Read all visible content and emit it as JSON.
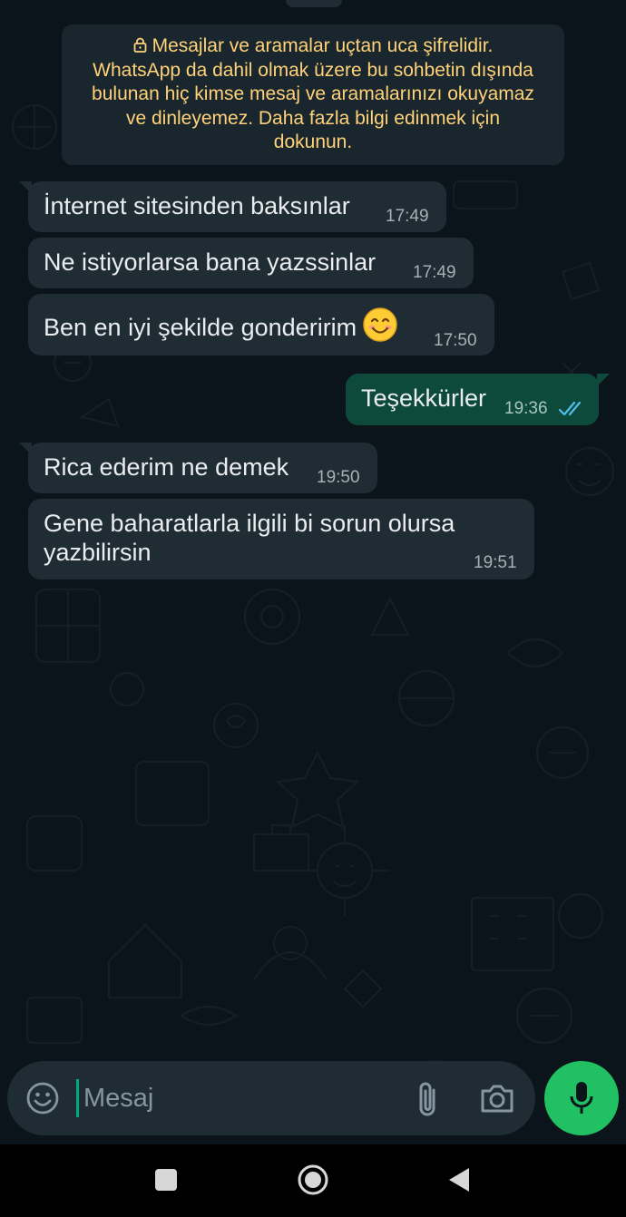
{
  "colors": {
    "background": "#0b141a",
    "incoming_bubble": "#202c33",
    "outgoing_bubble": "#0d4a3b",
    "banner_text": "#ffd279",
    "read_ticks": "#53bdeb",
    "mic_button": "#21c063",
    "cursor": "#00a884"
  },
  "encryption_notice": {
    "icon": "lock-icon",
    "lines": [
      "Mesajlar ve aramalar uçtan uca şifrelidir.",
      "WhatsApp da dahil olmak üzere bu sohbetin dışında",
      "bulunan hiç kimse mesaj ve aramalarınızı okuyamaz",
      "ve dinleyemez. Daha fazla bilgi edinmek için",
      "dokunun."
    ]
  },
  "messages": [
    {
      "direction": "in",
      "text": "İnternet sitesinden baksınlar",
      "time": "17:49"
    },
    {
      "direction": "in",
      "text": "Ne istiyorlarsa bana yazssinlar",
      "time": "17:49"
    },
    {
      "direction": "in",
      "text": "Ben en iyi şekilde gonderirim",
      "emoji": "smiling-face-icon",
      "time": "17:50"
    },
    {
      "direction": "out",
      "text": "Teşekkürler",
      "time": "19:36",
      "status": "read-double-check-icon"
    },
    {
      "direction": "in",
      "text": "Rica ederim ne demek",
      "time": "19:50"
    },
    {
      "direction": "in",
      "lines": [
        "Gene baharatlarla ilgili bi sorun olursa",
        "yazbilirsin"
      ],
      "time": "19:51"
    }
  ],
  "composer": {
    "placeholder": "Mesaj",
    "value": "",
    "emoji_icon": "emoji-icon",
    "attach_icon": "paperclip-icon",
    "camera_icon": "camera-icon",
    "mic_icon": "microphone-icon"
  },
  "system_nav": {
    "recents_icon": "square-recents-icon",
    "home_icon": "circle-home-icon",
    "back_icon": "triangle-back-icon"
  }
}
